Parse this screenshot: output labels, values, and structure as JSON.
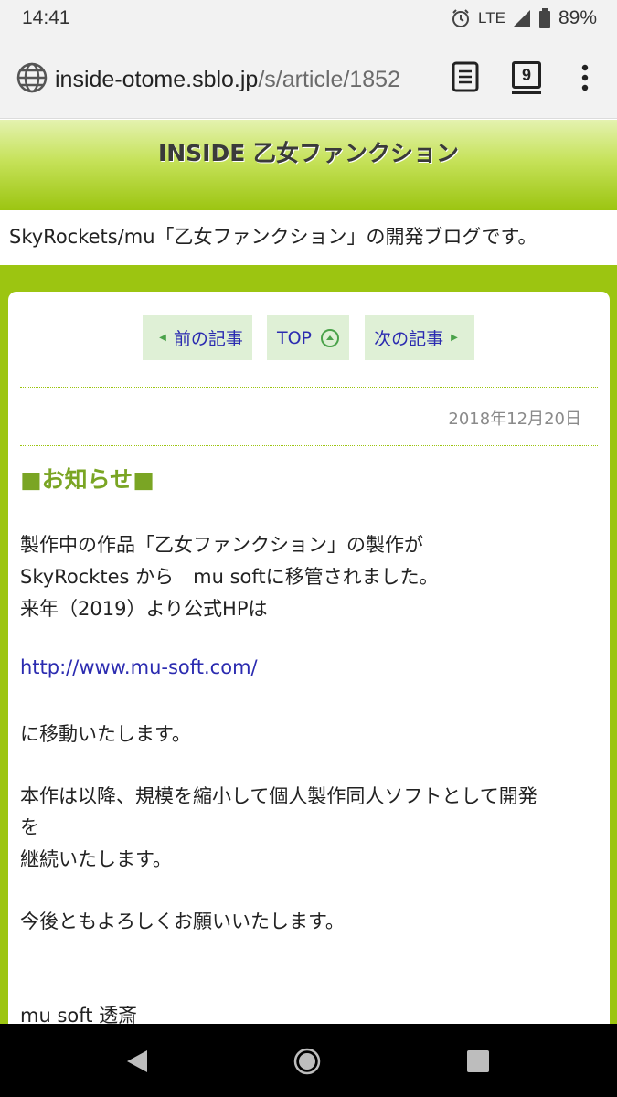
{
  "status": {
    "time": "14:41",
    "network": "LTE",
    "battery": "89%"
  },
  "browser": {
    "url_host": "inside-otome.sblo.jp",
    "url_path": "/s/article/1852",
    "tab_count": "9"
  },
  "site": {
    "title": "INSIDE 乙女ファンクション",
    "description": "SkyRockets/mu「乙女ファンクション」の開発ブログです。"
  },
  "pager": {
    "prev": "前の記事",
    "top": "TOP",
    "next": "次の記事"
  },
  "article": {
    "date": "2018年12月20日",
    "heading": "■お知らせ■",
    "lines": [
      "製作中の作品「乙女ファンクション」の製作が",
      "SkyRocktes から　mu softに移管されました。",
      "来年（2019）より公式HPは",
      "http://www.mu-soft.com/",
      "に移動いたします。",
      "本作は以降、規模を縮小して個人製作同人ソフトとして開発",
      "を",
      "継続いたします。",
      "今後ともよろしくお願いいたします。",
      "mu soft 透斎"
    ]
  },
  "icons": {
    "alarm": "alarm-icon",
    "signal": "signal-icon",
    "battery": "battery-icon",
    "globe": "globe-icon",
    "reader": "reader-mode-icon",
    "menu": "more-vert-icon",
    "back": "back-icon",
    "home": "home-icon",
    "recent": "recent-apps-icon"
  },
  "colors": {
    "accent_green": "#9cc511",
    "heading_green": "#7aa524",
    "link_blue": "#2b2bb0",
    "pager_bg": "#dff0d6"
  }
}
